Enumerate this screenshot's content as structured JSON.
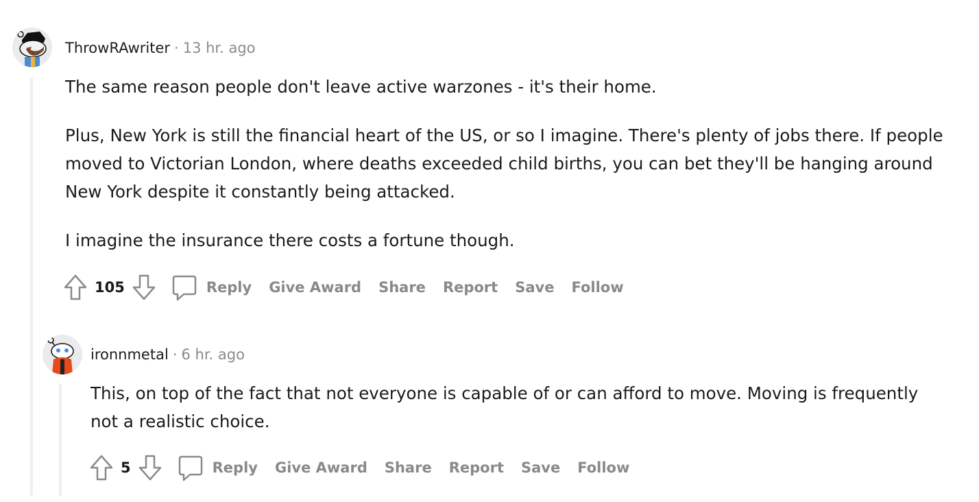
{
  "comments": [
    {
      "username": "ThrowRAwriter",
      "separator": "·",
      "time": "13 hr. ago",
      "paragraphs": [
        "The same reason people don't leave active warzones - it's their home.",
        "Plus, New York is still the financial heart of the US, or so I imagine. There's plenty of jobs there. If people moved to Victorian London, where deaths exceeded child births, you can bet they'll be hanging around New York despite it constantly being attacked.",
        "I imagine the insurance there costs a fortune though."
      ],
      "score": "105",
      "actions": {
        "reply": "Reply",
        "give_award": "Give Award",
        "share": "Share",
        "report": "Report",
        "save": "Save",
        "follow": "Follow"
      },
      "icons": {
        "upvote": "upvote-arrow-icon",
        "downvote": "downvote-arrow-icon",
        "comment": "comment-bubble-icon"
      }
    },
    {
      "username": "ironnmetal",
      "separator": "·",
      "time": "6 hr. ago",
      "paragraphs": [
        "This, on top of the fact that not everyone is capable of or can afford to move. Moving is frequently not a realistic choice."
      ],
      "score": "5",
      "actions": {
        "reply": "Reply",
        "give_award": "Give Award",
        "share": "Share",
        "report": "Report",
        "save": "Save",
        "follow": "Follow"
      },
      "icons": {
        "upvote": "upvote-arrow-icon",
        "downvote": "downvote-arrow-icon",
        "comment": "comment-bubble-icon"
      }
    }
  ],
  "colors": {
    "meta_gray": "#878a8c",
    "thread_line": "#edeff1",
    "text": "#1a1a1b"
  }
}
